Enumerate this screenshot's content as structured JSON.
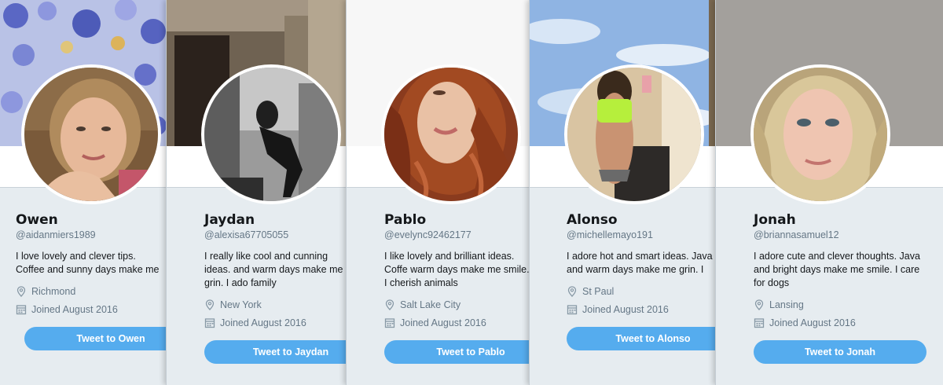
{
  "profiles": [
    {
      "name": "Owen",
      "handle": "@aidanmiers1989",
      "bio": "I love lovely and clever tips. Coffee and sunny days make me smile. I care f",
      "location": "Richmond",
      "joined": "Joined August 2016",
      "button": "Tweet to Owen"
    },
    {
      "name": "Jaydan",
      "handle": "@alexisa67705055",
      "bio": "I really like cool and cunning ideas. and warm days make me grin. I ado family",
      "location": "New York",
      "joined": "Joined August 2016",
      "button": "Tweet to Jaydan"
    },
    {
      "name": "Pablo",
      "handle": "@evelync92462177",
      "bio": "I like lovely and brilliant ideas. Coffe warm days make me smile. I cherish animals",
      "location": "Salt Lake City",
      "joined": "Joined August 2016",
      "button": "Tweet to Pablo"
    },
    {
      "name": "Alonso",
      "handle": "@michellemayo191",
      "bio": "I adore hot and smart ideas. Java and warm days make me grin. I care for f",
      "location": "St Paul",
      "joined": "Joined August 2016",
      "button": "Tweet to Alonso"
    },
    {
      "name": "Jonah",
      "handle": "@briannasamuel12",
      "bio": "I adore cute and clever thoughts. Java and bright days make me smile. I care for dogs",
      "location": "Lansing",
      "joined": "Joined August 2016",
      "button": "Tweet to Jonah"
    }
  ],
  "colors": {
    "button": "#55acee",
    "background": "#e6ecf0",
    "secondary_text": "#657786",
    "primary_text": "#14171a"
  },
  "icons": {
    "location": "location-pin-icon",
    "joined": "calendar-icon"
  }
}
